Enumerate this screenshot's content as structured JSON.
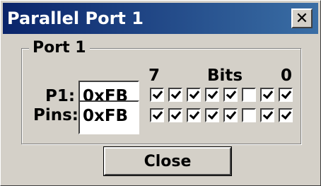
{
  "window": {
    "title": "Parallel Port 1",
    "close_glyph": "✕"
  },
  "group": {
    "label": "Port 1"
  },
  "bits_header": {
    "left": "7",
    "center": "Bits",
    "right": "0"
  },
  "rows": [
    {
      "label": "P1:",
      "value": "0xFB",
      "bits": [
        true,
        true,
        true,
        true,
        true,
        false,
        true,
        true
      ]
    },
    {
      "label": "Pins:",
      "value": "0xFB",
      "bits": [
        true,
        true,
        true,
        true,
        true,
        false,
        true,
        true
      ]
    }
  ],
  "buttons": {
    "close": "Close"
  }
}
